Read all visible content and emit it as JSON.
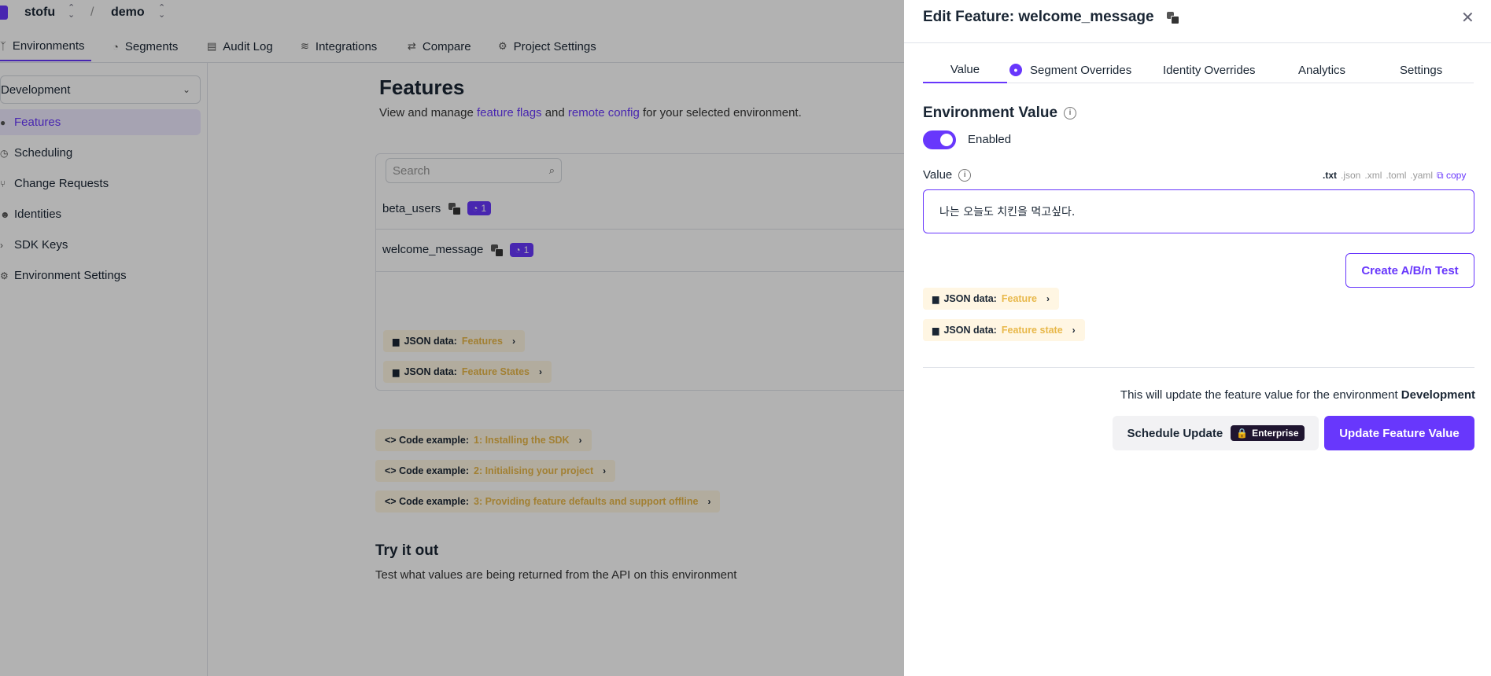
{
  "colors": {
    "accent": "#6837fc",
    "chip_bg": "#fff6e3",
    "chip_highlight": "#e8b84a"
  },
  "topbar": {
    "org": "stofu",
    "separator": "/",
    "project": "demo"
  },
  "nav_tabs": [
    {
      "label": "Environments",
      "icon": "environment-icon"
    },
    {
      "label": "Segments",
      "icon": "pie-icon"
    },
    {
      "label": "Audit Log",
      "icon": "list-icon"
    },
    {
      "label": "Integrations",
      "icon": "layers-icon"
    },
    {
      "label": "Compare",
      "icon": "compare-icon"
    },
    {
      "label": "Project Settings",
      "icon": "gear-icon"
    }
  ],
  "sidebar": {
    "environment": "Development",
    "items": [
      {
        "label": "Features"
      },
      {
        "label": "Scheduling"
      },
      {
        "label": "Change Requests"
      },
      {
        "label": "Identities"
      },
      {
        "label": "SDK Keys"
      },
      {
        "label": "Environment Settings"
      }
    ]
  },
  "main": {
    "title": "Features",
    "subtitle_pre": "View and manage ",
    "link1": "feature flags",
    "subtitle_mid": " and ",
    "link2": "remote config",
    "subtitle_post": " for your selected environment.",
    "search_placeholder": "Search",
    "features": [
      {
        "name": "beta_users",
        "badge": "1"
      },
      {
        "name": "welcome_message",
        "badge": "1"
      }
    ],
    "json_chips": [
      {
        "prefix": "JSON data:",
        "label": "Features"
      },
      {
        "prefix": "JSON data:",
        "label": "Feature States"
      }
    ],
    "code_chips": [
      {
        "prefix": "<> Code example:",
        "label": "1: Installing the SDK"
      },
      {
        "prefix": "<> Code example:",
        "label": "2: Initialising your project"
      },
      {
        "prefix": "<> Code example:",
        "label": "3: Providing feature defaults and support offline"
      }
    ],
    "try_title": "Try it out",
    "try_subtitle": "Test what values are being returned from the API on this environment"
  },
  "drawer": {
    "title": "Edit Feature: welcome_message",
    "tabs": [
      "Value",
      "Segment Overrides",
      "Identity Overrides",
      "Analytics",
      "Settings"
    ],
    "env_value_title": "Environment Value",
    "toggle_label": "Enabled",
    "toggle_on": true,
    "value_label": "Value",
    "formats": [
      ".txt",
      ".json",
      ".xml",
      ".toml",
      ".yaml"
    ],
    "copy_label": "copy",
    "value_text": "나는 오늘도 치킨을 먹고싶다.",
    "ab_button": "Create A/B/n Test",
    "json_chips": [
      {
        "prefix": "JSON data:",
        "label": "Feature"
      },
      {
        "prefix": "JSON data:",
        "label": "Feature state"
      }
    ],
    "update_note": "This will update the feature value for the environment",
    "update_env": "Development",
    "schedule_button": "Schedule Update",
    "enterprise_badge": "Enterprise",
    "update_button": "Update Feature Value"
  }
}
